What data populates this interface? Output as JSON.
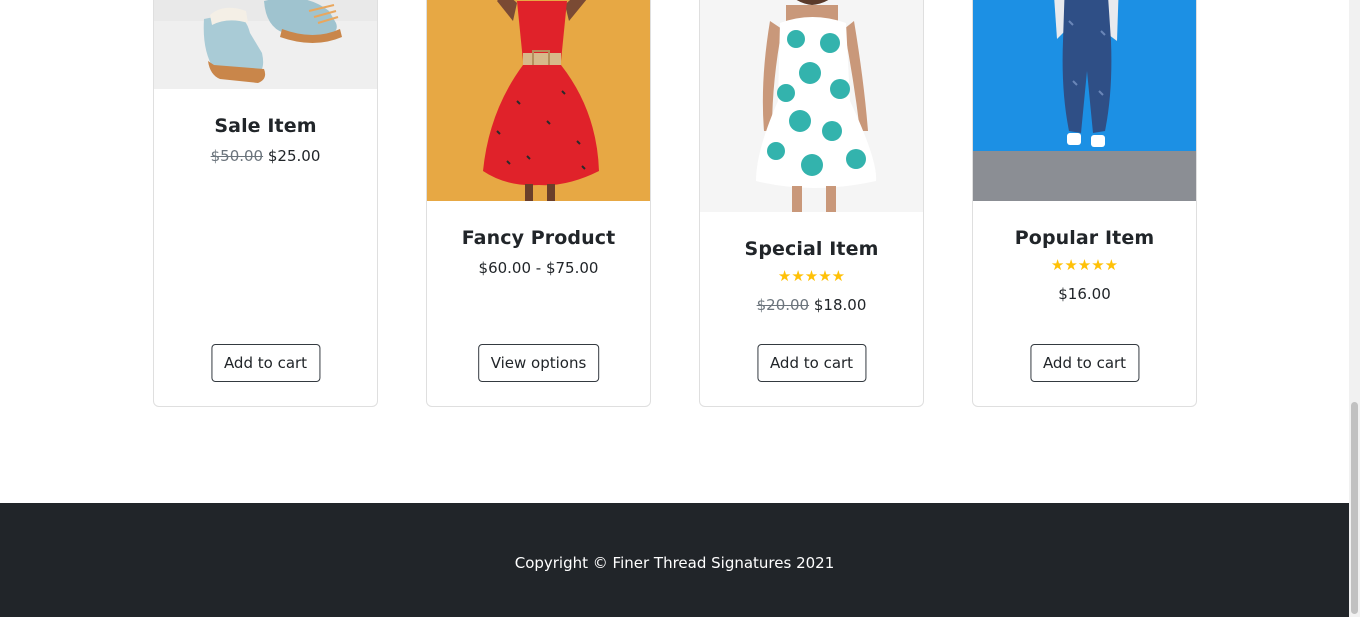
{
  "products": [
    {
      "title": "Sale Item",
      "old_price": "$50.00",
      "price": "$25.00",
      "button": "Add to cart",
      "image": "boots-photo"
    },
    {
      "title": "Fancy Product",
      "price_range": "$60.00 - $75.00",
      "button": "View options",
      "image": "red-dress-photo"
    },
    {
      "title": "Special Item",
      "stars": "★★★★★",
      "rating": 5,
      "old_price": "$20.00",
      "price": "$18.00",
      "button": "Add to cart",
      "image": "teal-floral-dress-photo"
    },
    {
      "title": "Popular Item",
      "stars": "★★★★★",
      "rating": 5,
      "price": "$16.00",
      "button": "Add to cart",
      "image": "denim-overalls-photo"
    }
  ],
  "footer": {
    "copyright": "Copyright © Finer Thread Signatures 2021"
  },
  "colors": {
    "footer_bg": "#212529",
    "star": "#ffc107",
    "button_border": "#343a40"
  }
}
